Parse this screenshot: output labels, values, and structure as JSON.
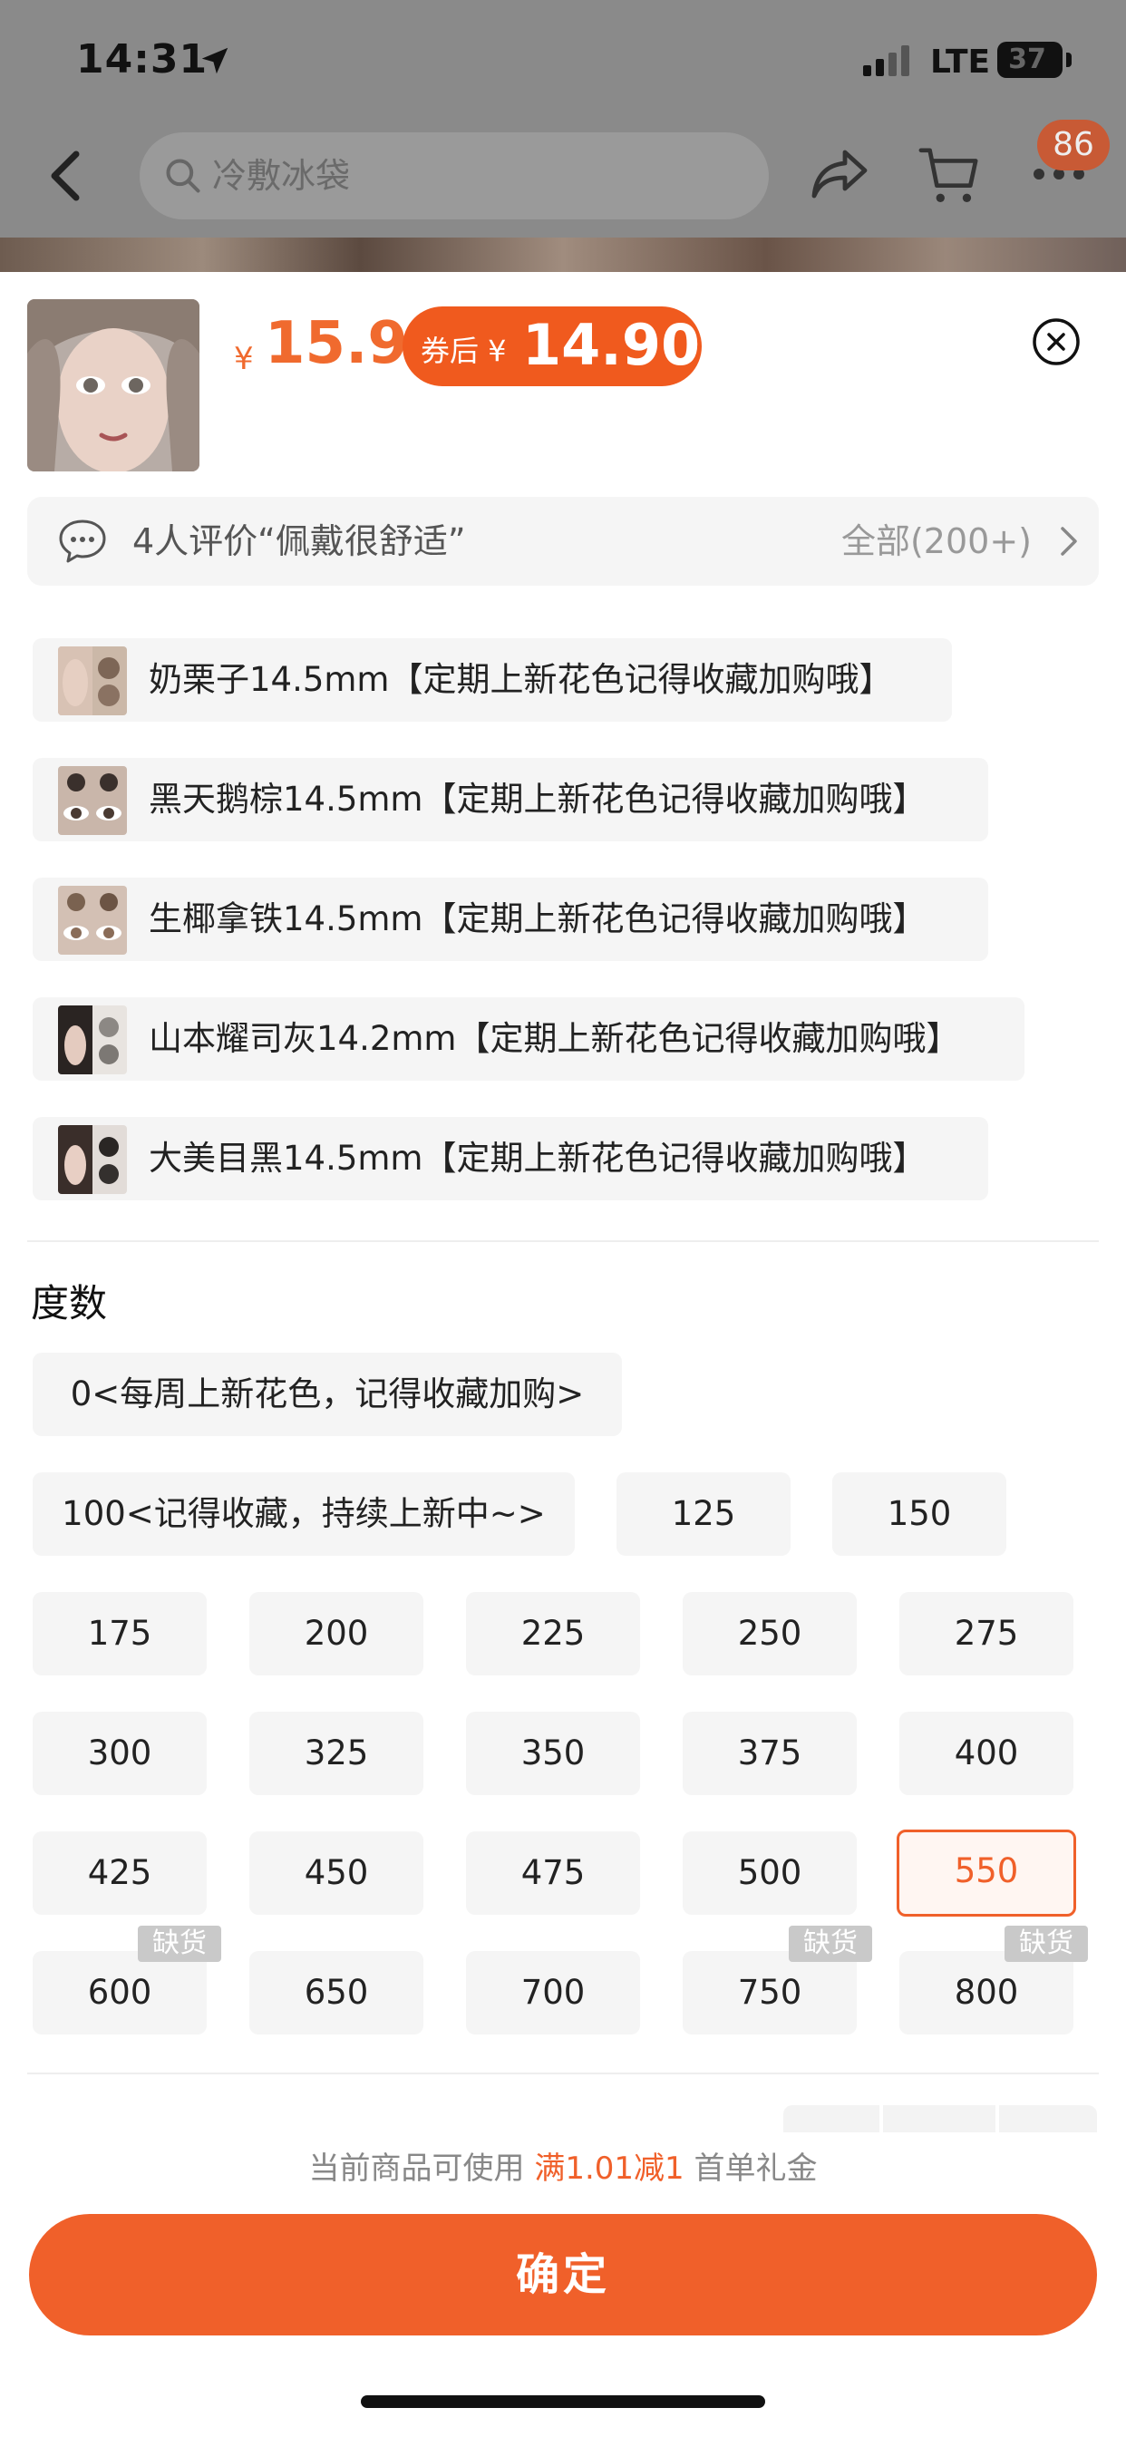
{
  "status_bar": {
    "time": "14:31",
    "network": "LTE",
    "battery": "37"
  },
  "nav": {
    "search_placeholder": "冷敷冰袋",
    "cart_badge": "86"
  },
  "product": {
    "price_symbol": "¥",
    "price": "15.9",
    "coupon_prefix": "券后 ¥",
    "coupon_price": "14.90"
  },
  "review": {
    "text": "4人评价“佩戴很舒适”",
    "all_label": "全部(200+)"
  },
  "colors": [
    {
      "label": "奶栗子14.5mm【定期上新花色记得收藏加购哦】"
    },
    {
      "label": "黑天鹅棕14.5mm【定期上新花色记得收藏加购哦】"
    },
    {
      "label": "生椰拿铁14.5mm【定期上新花色记得收藏加购哦】"
    },
    {
      "label": "山本耀司灰14.2mm【定期上新花色记得收藏加购哦】"
    },
    {
      "label": "大美目黑14.5mm【定期上新花色记得收藏加购哦】"
    }
  ],
  "power_section": {
    "title": "度数",
    "selected": "550",
    "out_of_stock_label": "缺货",
    "options": [
      "0<每周上新花色，记得收藏加购>",
      "100<记得收藏，持续上新中~>",
      "125",
      "150",
      "175",
      "200",
      "225",
      "250",
      "275",
      "300",
      "325",
      "350",
      "375",
      "400",
      "425",
      "450",
      "475",
      "500",
      "550",
      "600",
      "650",
      "700",
      "750",
      "800"
    ]
  },
  "promo": {
    "prefix": "当前商品可使用 ",
    "highlight": "满1.01减1",
    "suffix": " 首单礼金"
  },
  "confirm_label": "确定",
  "colors_theme": {
    "accent": "#f0602a",
    "option_bg": "#f5f5f5"
  }
}
